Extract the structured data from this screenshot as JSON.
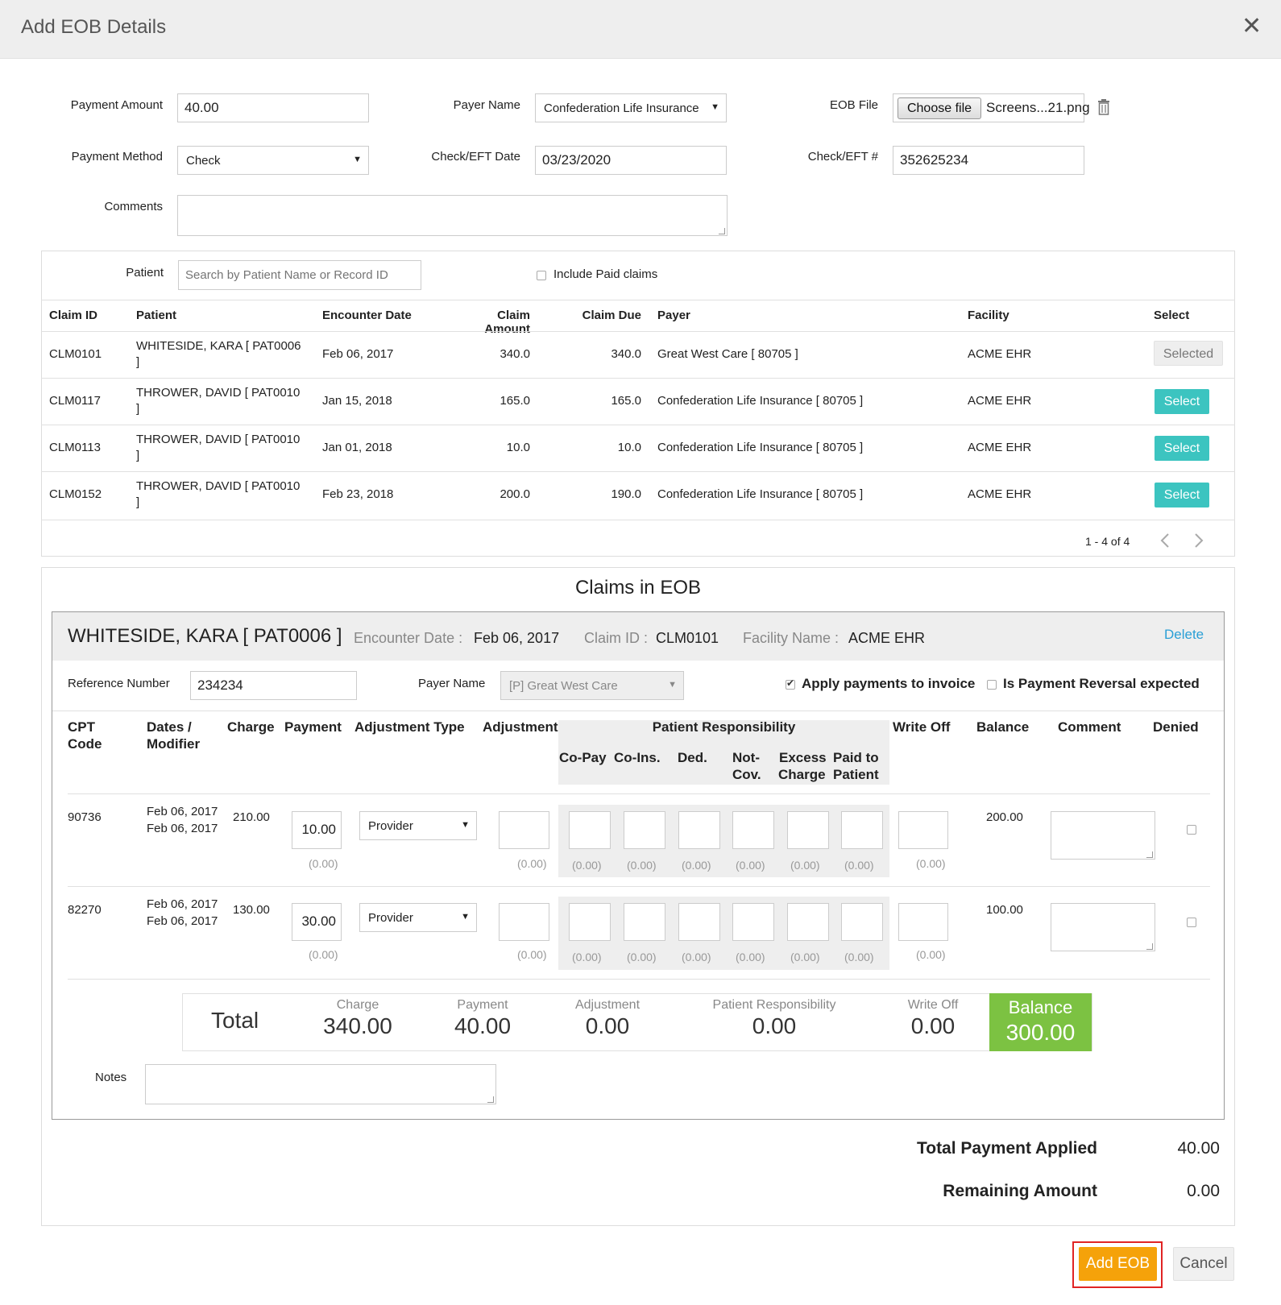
{
  "dialog": {
    "title": "Add EOB Details"
  },
  "form": {
    "payment_amount_label": "Payment Amount",
    "payment_amount": "40.00",
    "payer_name_label": "Payer Name",
    "payer_name": "Confederation Life Insurance",
    "eob_file_label": "EOB File",
    "choose_file_label": "Choose file",
    "file_name": "Screens...21.png",
    "payment_method_label": "Payment Method",
    "payment_method": "Check",
    "check_date_label": "Check/EFT Date",
    "check_date": "03/23/2020",
    "check_no_label": "Check/EFT #",
    "check_no": "352625234",
    "comments_label": "Comments"
  },
  "search": {
    "patient_label": "Patient",
    "placeholder": "Search by Patient Name or Record ID",
    "include_paid_label": "Include Paid claims"
  },
  "claims_table": {
    "headers": [
      "Claim ID",
      "Patient",
      "Encounter Date",
      "Claim Amount",
      "Claim Due",
      "Payer",
      "Facility",
      "Select"
    ],
    "rows": [
      {
        "claim_id": "CLM0101",
        "patient_line1": "WHITESIDE, KARA [ PAT0006",
        "patient_line2": "]",
        "date": "Feb 06, 2017",
        "amount": "340.0",
        "due": "340.0",
        "payer": "Great West Care [ 80705 ]",
        "facility": "ACME EHR",
        "action": "Selected"
      },
      {
        "claim_id": "CLM0117",
        "patient_line1": "THROWER, DAVID [ PAT0010",
        "patient_line2": "]",
        "date": "Jan 15, 2018",
        "amount": "165.0",
        "due": "165.0",
        "payer": "Confederation Life Insurance [ 80705 ]",
        "facility": "ACME EHR",
        "action": "Select"
      },
      {
        "claim_id": "CLM0113",
        "patient_line1": "THROWER, DAVID [ PAT0010",
        "patient_line2": "]",
        "date": "Jan 01, 2018",
        "amount": "10.0",
        "due": "10.0",
        "payer": "Confederation Life Insurance [ 80705 ]",
        "facility": "ACME EHR",
        "action": "Select"
      },
      {
        "claim_id": "CLM0152",
        "patient_line1": "THROWER, DAVID [ PAT0010",
        "patient_line2": "]",
        "date": "Feb 23, 2018",
        "amount": "200.0",
        "due": "190.0",
        "payer": "Confederation Life Insurance [ 80705 ]",
        "facility": "ACME EHR",
        "action": "Select"
      }
    ],
    "pagination": "1 - 4 of 4"
  },
  "eob": {
    "section_title": "Claims in EOB",
    "patient": "WHITESIDE, KARA [ PAT0006 ]",
    "encounter_label": "Encounter Date :",
    "encounter_value": "Feb 06, 2017",
    "claim_label": "Claim ID :",
    "claim_value": "CLM0101",
    "facility_label": "Facility Name :",
    "facility_value": "ACME EHR",
    "delete_label": "Delete",
    "ref_label": "Reference Number",
    "ref_value": "234234",
    "payer_label": "Payer Name",
    "payer_value": "[P] Great West Care",
    "apply_label": "Apply payments to invoice",
    "reversal_label": "Is Payment Reversal expected",
    "headers": {
      "cpt1": "CPT",
      "cpt2": "Code",
      "dates1": "Dates /",
      "dates2": "Modifier",
      "charge": "Charge",
      "payment": "Payment",
      "adj_type": "Adjustment Type",
      "adjustment": "Adjustment",
      "patient_resp": "Patient Responsibility",
      "copay": "Co-Pay",
      "coins": "Co-Ins.",
      "ded": "Ded.",
      "notcov1": "Not-",
      "notcov2": "Cov.",
      "excess1": "Excess",
      "excess2": "Charge",
      "paid1": "Paid to",
      "paid2": "Patient",
      "writeoff": "Write Off",
      "balance": "Balance",
      "comment": "Comment",
      "denied": "Denied"
    },
    "lines": [
      {
        "cpt": "90736",
        "date1": "Feb 06, 2017",
        "date2": "Feb 06, 2017",
        "charge": "210.00",
        "payment": "10.00",
        "adj_type": "Provider",
        "balance": "200.00",
        "hint": "(0.00)"
      },
      {
        "cpt": "82270",
        "date1": "Feb 06, 2017",
        "date2": "Feb 06, 2017",
        "charge": "130.00",
        "payment": "30.00",
        "adj_type": "Provider",
        "balance": "100.00",
        "hint": "(0.00)"
      }
    ],
    "totals": {
      "label": "Total",
      "charge_label": "Charge",
      "charge": "340.00",
      "payment_label": "Payment",
      "payment": "40.00",
      "adjustment_label": "Adjustment",
      "adjustment": "0.00",
      "patient_resp_label": "Patient Responsibility",
      "patient_resp": "0.00",
      "writeoff_label": "Write Off",
      "writeoff": "0.00",
      "balance_label": "Balance",
      "balance": "300.00"
    },
    "notes_label": "Notes"
  },
  "summary": {
    "total_applied_label": "Total Payment Applied",
    "total_applied": "40.00",
    "remaining_label": "Remaining Amount",
    "remaining": "0.00"
  },
  "footer": {
    "add_label": "Add EOB",
    "cancel_label": "Cancel"
  },
  "colors": {
    "teal": "#3cc4c0",
    "green": "#7cc242",
    "orange": "#f5a20a",
    "highlight": "#e02424",
    "link": "#2a9fd6"
  }
}
